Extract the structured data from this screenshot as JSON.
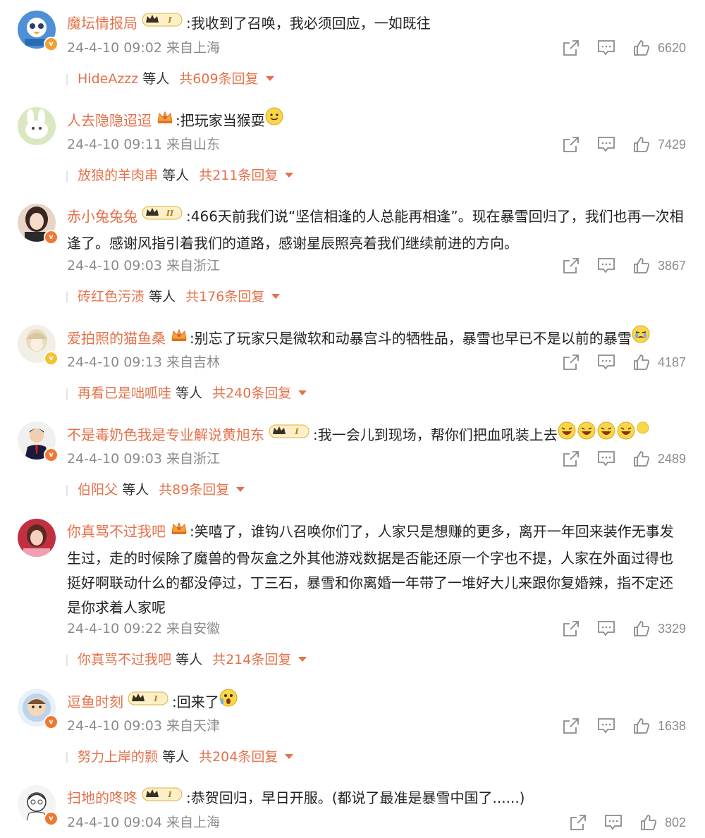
{
  "comments": [
    {
      "username": "魔坛情报局",
      "text": ":我收到了召唤，我必须回应，一如既往",
      "rank": "I",
      "time": "24-4-10 09:02",
      "location": "来自上海",
      "likes": "6620",
      "reply_user": "HideAzzz",
      "reply_mid": "等人",
      "reply_total": "共609条回复",
      "badge_color": "#f0a030"
    },
    {
      "username": "人去隐隐迢迢",
      "text": ":把玩家当猴耍",
      "rank": "",
      "time": "24-4-10 09:11",
      "location": "来自山东",
      "likes": "7429",
      "reply_user": "放狼的羊肉串",
      "reply_mid": "等人",
      "reply_total": "共211条回复"
    },
    {
      "username": "赤小兔兔兔",
      "text": ":466天前我们说“坚信相逢的人总能再相逢”。现在暴雪回归了，我们也再一次相逢了。感谢风指引着我们的道路，感谢星辰照亮着我们继续前进的方向。",
      "rank": "II",
      "time": "24-4-10 09:03",
      "location": "来自浙江",
      "likes": "3867",
      "reply_user": "砖红色污渍",
      "reply_mid": "等人",
      "reply_total": "共176条回复",
      "badge_color": "#f07830"
    },
    {
      "username": "爱拍照的猫鱼桑",
      "text": ":别忘了玩家只是微软和动暴宫斗的牺牲品，暴雪也早已不是以前的暴雪",
      "rank": "",
      "time": "24-4-10 09:13",
      "location": "来自吉林",
      "likes": "4187",
      "reply_user": "再看已是咄呱哇",
      "reply_mid": "等人",
      "reply_total": "共240条回复",
      "badge_color": "#f2c230"
    },
    {
      "username": "不是毒奶色我是专业解说黄旭东",
      "text": ":我一会儿到现场，帮你们把血吼装上去",
      "rank": "I",
      "time": "24-4-10 09:03",
      "location": "来自浙江",
      "likes": "2489",
      "reply_user": "伯阳父",
      "reply_mid": "等人",
      "reply_total": "共89条回复",
      "badge_color": "#f07830"
    },
    {
      "username": "你真骂不过我吧",
      "text": ":笑嘻了，谁钩八召唤你们了，人家只是想赚的更多，离开一年回来装作无事发生过，走的时候除了魔兽的骨灰盒之外其他游戏数据是否能还原一个字也不提，人家在外面过得也挺好啊联动什么的都没停过，丁三石，暴雪和你离婚一年带了一堆好大儿来跟你复婚辣，指不定还是你求着人家呢",
      "rank": "",
      "time": "24-4-10 09:22",
      "location": "来自安徽",
      "likes": "3329",
      "reply_user": "你真骂不过我吧",
      "reply_mid": "等人",
      "reply_total": "共214条回复"
    },
    {
      "username": "逗鱼时刻",
      "text": ":回来了",
      "rank": "I",
      "time": "24-4-10 09:03",
      "location": "来自天津",
      "likes": "1638",
      "reply_user": "努力上岸的颢",
      "reply_mid": "等人",
      "reply_total": "共204条回复",
      "badge_color": "#f07830"
    },
    {
      "username": "扫地的咚咚",
      "text": ":恭贺回归，早日开服。(都说了最准是暴雪中国了......)",
      "rank": "I",
      "time": "24-4-10 09:04",
      "location": "来自上海",
      "likes": "802",
      "badge_color": "#f07830"
    }
  ],
  "icons": {
    "share": "share-icon",
    "comment": "comment-icon",
    "like": "thumbs-up-icon",
    "caret": "caret-down-icon"
  },
  "colors": {
    "username": "#e5714a",
    "meta": "#8b8b8b",
    "text": "#222222"
  }
}
